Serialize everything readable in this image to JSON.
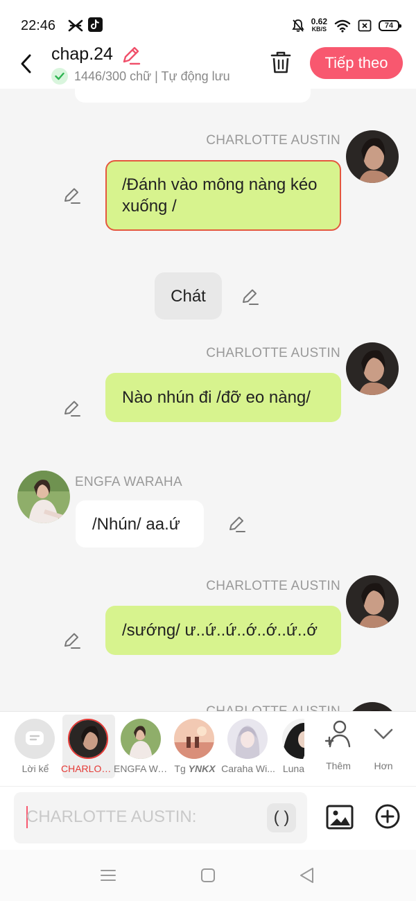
{
  "status_bar": {
    "time": "22:46",
    "net_speed_value": "0.62",
    "net_speed_unit": "KB/S",
    "battery_level": "74"
  },
  "header": {
    "title": "chap.24",
    "word_count": "1446/300 chữ",
    "autosave": "Tự động lưu",
    "separator": "|",
    "next_label": "Tiếp theo",
    "accent_color": "#f8586f"
  },
  "messages": [
    {
      "speaker": "CHARLOTTE AUSTIN",
      "side": "right",
      "text": "/Đánh vào mông nàng kéo xuống /",
      "selected": true
    },
    {
      "speaker": "",
      "side": "center",
      "text": "Chát"
    },
    {
      "speaker": "CHARLOTTE AUSTIN",
      "side": "right",
      "text": "Nào nhún đi /đỡ eo nàng/"
    },
    {
      "speaker": "ENGFA WARAHA",
      "side": "left",
      "text": "/Nhún/ aa.ứ"
    },
    {
      "speaker": "CHARLOTTE AUSTIN",
      "side": "right",
      "text": "/sướng/ ư..ứ..ứ..ớ..ớ..ứ..ớ"
    },
    {
      "speaker": "CHARLOTTE AUSTIN",
      "side": "right",
      "text": ""
    }
  ],
  "characters": [
    {
      "name": "Lời kể",
      "icon": "narrator-icon"
    },
    {
      "name": "CHARLOTTE AUSTIN",
      "selected": true
    },
    {
      "name": "ENGFA WARAHA"
    },
    {
      "name_prefix": "Tg ",
      "name_bold": "YNKX"
    },
    {
      "name": "Caraha Wi..."
    },
    {
      "name": "Luna"
    }
  ],
  "char_actions": {
    "more_label": "Thêm",
    "expand_label": "Hơn"
  },
  "composer": {
    "placeholder": "CHARLOTTE AUSTIN:",
    "paren_label": "( )"
  },
  "colors": {
    "bubble_green": "#d7f38e",
    "selected_border": "#e4573e",
    "speaker_gray": "#999999"
  }
}
